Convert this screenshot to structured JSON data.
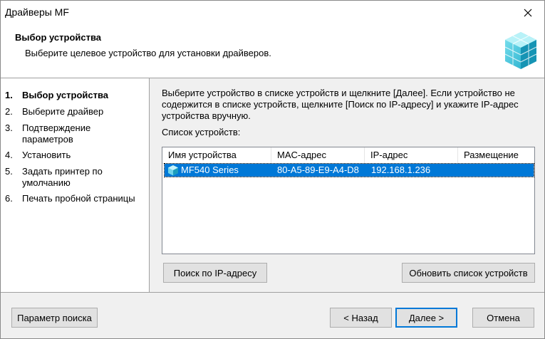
{
  "window": {
    "title": "Драйверы MF"
  },
  "header": {
    "title": "Выбор устройства",
    "subtitle": "Выберите целевое устройство для установки драйверов."
  },
  "steps": [
    {
      "num": "1.",
      "label": "Выбор устройства",
      "active": true
    },
    {
      "num": "2.",
      "label": "Выберите драйвер",
      "active": false
    },
    {
      "num": "3.",
      "label": "Подтверждение параметров",
      "active": false
    },
    {
      "num": "4.",
      "label": "Установить",
      "active": false
    },
    {
      "num": "5.",
      "label": "Задать принтер по умолчанию",
      "active": false
    },
    {
      "num": "6.",
      "label": "Печать пробной страницы",
      "active": false
    }
  ],
  "content": {
    "instructions": "Выберите устройство в списке устройств и щелкните [Далее]. Если устройство не содержится в списке устройств, щелкните [Поиск по IP-адресу] и укажите IP-адрес устройства вручную.",
    "list_label": "Список устройств:",
    "columns": [
      "Имя устройства",
      "MAC-адрес",
      "IP-адрес",
      "Размещение"
    ],
    "rows": [
      {
        "name": "MF540 Series",
        "mac": "80-A5-89-E9-A4-D8",
        "ip": "192.168.1.236",
        "location": "",
        "selected": true
      }
    ],
    "search_ip_label": "Поиск по IP-адресу",
    "refresh_label": "Обновить список устройств"
  },
  "footer": {
    "search_params_label": "Параметр поиска",
    "back_label": "< Назад",
    "next_label": "Далее >",
    "cancel_label": "Отмена"
  },
  "colors": {
    "selection": "#0078d7",
    "default_button_border": "#0078d7",
    "window_bg": "#f0f0f0"
  },
  "icons": {
    "close": "close-icon",
    "header": "cube-blocks-icon",
    "device": "printer-device-icon"
  }
}
